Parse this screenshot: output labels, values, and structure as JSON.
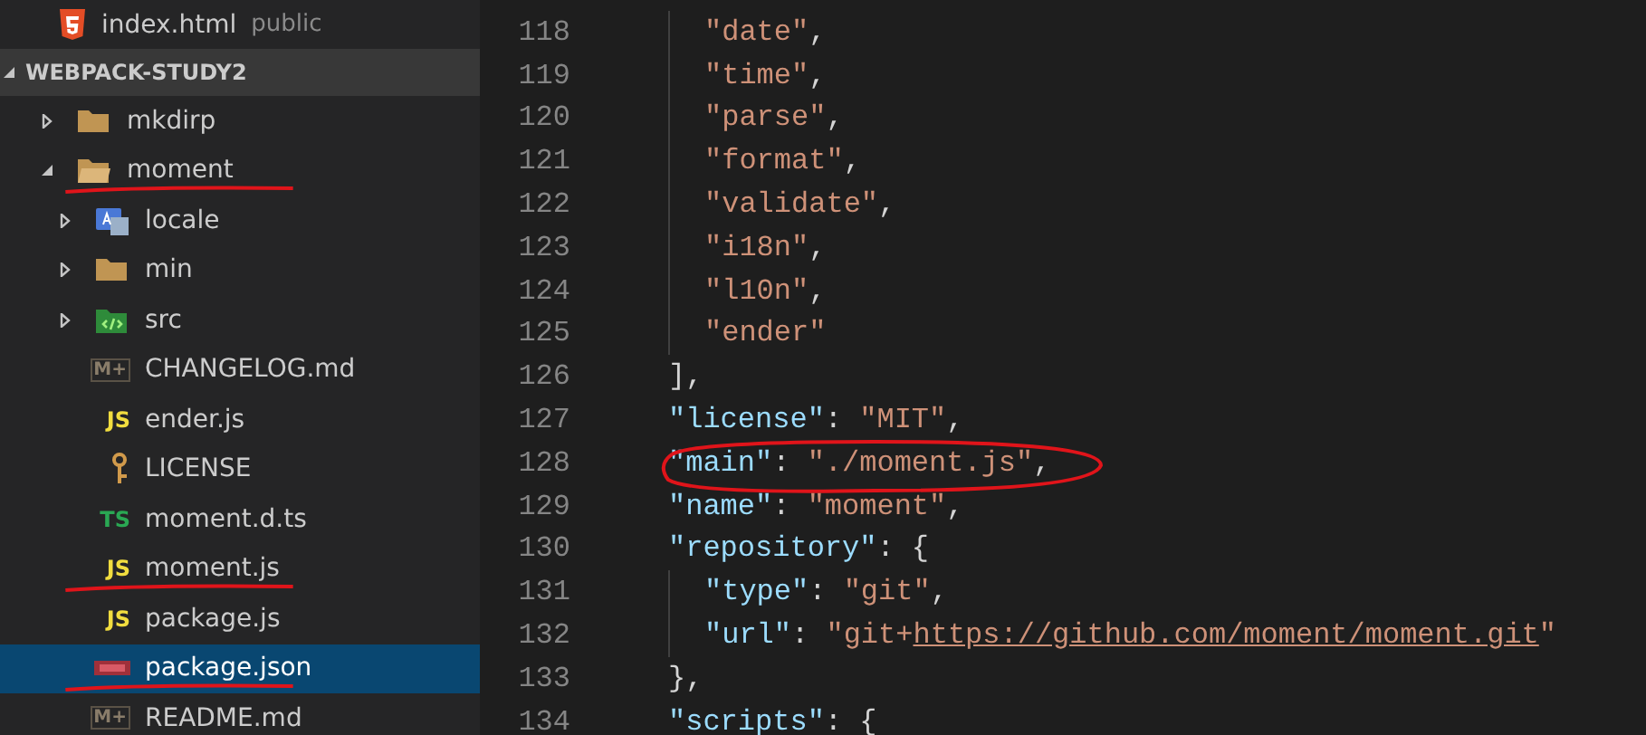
{
  "open_editor": {
    "kind": "html",
    "name": "index.html",
    "folder": "public"
  },
  "explorer": {
    "title": "WEBPACK-STUDY2",
    "expanded": true,
    "items": [
      {
        "name": "mkdirp",
        "kind": "folder",
        "expanded": false,
        "selected": false,
        "underlined": false
      },
      {
        "name": "moment",
        "kind": "folder",
        "expanded": true,
        "selected": false,
        "underlined": true,
        "children": [
          {
            "name": "locale",
            "kind": "locale-folder",
            "expanded": false,
            "selected": false,
            "underlined": false
          },
          {
            "name": "min",
            "kind": "folder",
            "expanded": false,
            "selected": false,
            "underlined": false
          },
          {
            "name": "src",
            "kind": "src-folder",
            "expanded": false,
            "selected": false,
            "underlined": false
          },
          {
            "name": "CHANGELOG.md",
            "kind": "markdown",
            "badge": "M+",
            "selected": false,
            "underlined": false
          },
          {
            "name": "ender.js",
            "kind": "js",
            "badge": "JS",
            "selected": false,
            "underlined": false
          },
          {
            "name": "LICENSE",
            "kind": "license",
            "selected": false,
            "underlined": false
          },
          {
            "name": "moment.d.ts",
            "kind": "ts",
            "badge": "TS",
            "selected": false,
            "underlined": false
          },
          {
            "name": "moment.js",
            "kind": "js",
            "badge": "JS",
            "selected": false,
            "underlined": true
          },
          {
            "name": "package.js",
            "kind": "js",
            "badge": "JS",
            "selected": false,
            "underlined": false
          },
          {
            "name": "package.json",
            "kind": "npm",
            "selected": true,
            "underlined": true
          },
          {
            "name": "README.md",
            "kind": "markdown",
            "badge": "M+",
            "selected": false,
            "underlined": false
          }
        ]
      }
    ]
  },
  "editor": {
    "lines": [
      {
        "number": "118",
        "kind": "inner",
        "circled": false,
        "tokens": [
          {
            "kind": "string",
            "text": "\"date\""
          },
          {
            "kind": "punct",
            "text": ","
          }
        ]
      },
      {
        "number": "119",
        "kind": "inner",
        "circled": false,
        "tokens": [
          {
            "kind": "string",
            "text": "\"time\""
          },
          {
            "kind": "punct",
            "text": ","
          }
        ]
      },
      {
        "number": "120",
        "kind": "inner",
        "circled": false,
        "tokens": [
          {
            "kind": "string",
            "text": "\"parse\""
          },
          {
            "kind": "punct",
            "text": ","
          }
        ]
      },
      {
        "number": "121",
        "kind": "inner",
        "circled": false,
        "tokens": [
          {
            "kind": "string",
            "text": "\"format\""
          },
          {
            "kind": "punct",
            "text": ","
          }
        ]
      },
      {
        "number": "122",
        "kind": "inner",
        "circled": false,
        "tokens": [
          {
            "kind": "string",
            "text": "\"validate\""
          },
          {
            "kind": "punct",
            "text": ","
          }
        ]
      },
      {
        "number": "123",
        "kind": "inner",
        "circled": false,
        "tokens": [
          {
            "kind": "string",
            "text": "\"i18n\""
          },
          {
            "kind": "punct",
            "text": ","
          }
        ]
      },
      {
        "number": "124",
        "kind": "inner",
        "circled": false,
        "tokens": [
          {
            "kind": "string",
            "text": "\"l10n\""
          },
          {
            "kind": "punct",
            "text": ","
          }
        ]
      },
      {
        "number": "125",
        "kind": "inner",
        "circled": false,
        "tokens": [
          {
            "kind": "string",
            "text": "\"ender\""
          }
        ]
      },
      {
        "number": "126",
        "kind": "outer",
        "circled": false,
        "tokens": [
          {
            "kind": "punct",
            "text": "],"
          }
        ]
      },
      {
        "number": "127",
        "kind": "outer",
        "circled": false,
        "tokens": [
          {
            "kind": "key",
            "text": "\"license\""
          },
          {
            "kind": "punct",
            "text": ":"
          },
          {
            "kind": "string",
            "text": "\"MIT\""
          },
          {
            "kind": "punct",
            "text": ","
          }
        ]
      },
      {
        "number": "128",
        "kind": "outer",
        "circled": true,
        "tokens": [
          {
            "kind": "key",
            "text": "\"main\""
          },
          {
            "kind": "punct",
            "text": ":"
          },
          {
            "kind": "string",
            "text": "\"./moment.js\""
          },
          {
            "kind": "punct",
            "text": ","
          }
        ]
      },
      {
        "number": "129",
        "kind": "outer",
        "circled": false,
        "tokens": [
          {
            "kind": "key",
            "text": "\"name\""
          },
          {
            "kind": "punct",
            "text": ":"
          },
          {
            "kind": "string",
            "text": "\"moment\""
          },
          {
            "kind": "punct",
            "text": ","
          }
        ]
      },
      {
        "number": "130",
        "kind": "outer",
        "circled": false,
        "tokens": [
          {
            "kind": "key",
            "text": "\"repository\""
          },
          {
            "kind": "punct",
            "text": ":"
          },
          {
            "kind": "punct",
            "text": "{"
          }
        ]
      },
      {
        "number": "131",
        "kind": "inner",
        "circled": false,
        "tokens": [
          {
            "kind": "key",
            "text": "\"type\""
          },
          {
            "kind": "punct",
            "text": ":"
          },
          {
            "kind": "string",
            "text": "\"git\""
          },
          {
            "kind": "punct",
            "text": ","
          }
        ]
      },
      {
        "number": "132",
        "kind": "inner",
        "circled": false,
        "tokens": [
          {
            "kind": "key",
            "text": "\"url\""
          },
          {
            "kind": "punct",
            "text": ":"
          },
          {
            "kind": "string",
            "text": "\"git+"
          },
          {
            "kind": "link",
            "text": "https://github.com/moment/moment.git"
          },
          {
            "kind": "string",
            "text": "\""
          }
        ]
      },
      {
        "number": "133",
        "kind": "outer",
        "circled": false,
        "tokens": [
          {
            "kind": "punct",
            "text": "},"
          }
        ]
      },
      {
        "number": "134",
        "kind": "outer",
        "circled": false,
        "tokens": [
          {
            "kind": "key",
            "text": "\"scripts\""
          },
          {
            "kind": "punct",
            "text": ":"
          },
          {
            "kind": "punct",
            "text": "{"
          }
        ]
      }
    ]
  }
}
